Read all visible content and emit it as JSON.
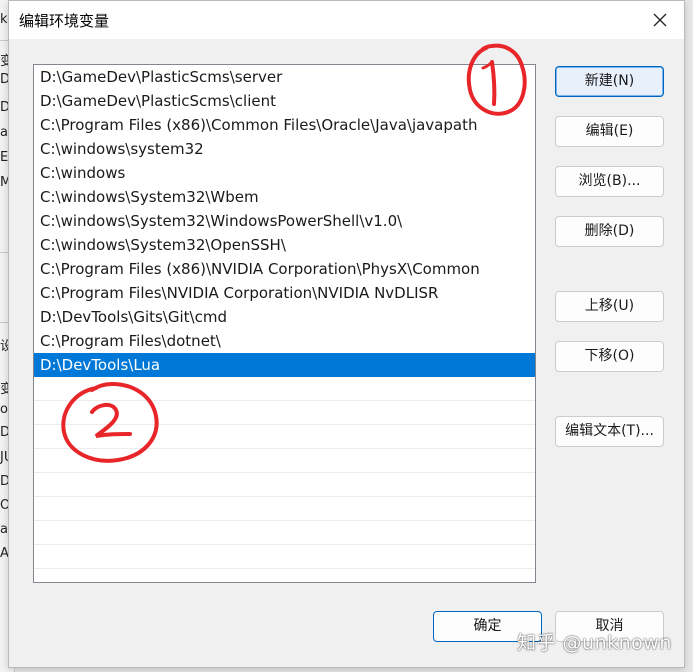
{
  "background_window": {
    "fragments": [
      "ke",
      "变",
      "Dr",
      "Dr",
      "a",
      "E",
      "M",
      "设",
      "变",
      "o",
      "Dr",
      "JU",
      "Dr",
      "OS",
      "a",
      "A"
    ]
  },
  "dialog": {
    "title": "编辑环境变量",
    "close_icon": "close-icon"
  },
  "paths": [
    "D:\\GameDev\\PlasticScms\\server",
    "D:\\GameDev\\PlasticScms\\client",
    "C:\\Program Files (x86)\\Common Files\\Oracle\\Java\\javapath",
    "C:\\windows\\system32",
    "C:\\windows",
    "C:\\windows\\System32\\Wbem",
    "C:\\windows\\System32\\WindowsPowerShell\\v1.0\\",
    "C:\\windows\\System32\\OpenSSH\\",
    "C:\\Program Files (x86)\\NVIDIA Corporation\\PhysX\\Common",
    "C:\\Program Files\\NVIDIA Corporation\\NVIDIA NvDLISR",
    "D:\\DevTools\\Gits\\Git\\cmd",
    "C:\\Program Files\\dotnet\\",
    "D:\\DevTools\\Lua"
  ],
  "selected_index": 12,
  "buttons": {
    "new": "新建(N)",
    "edit": "编辑(E)",
    "browse": "浏览(B)...",
    "delete": "删除(D)",
    "move_up": "上移(U)",
    "move_down": "下移(O)",
    "edit_text": "编辑文本(T)...",
    "ok": "确定",
    "cancel": "取消"
  },
  "colors": {
    "selection": "#0078d7",
    "annotation": "#e8262a"
  },
  "watermark": "知乎 @unknown"
}
